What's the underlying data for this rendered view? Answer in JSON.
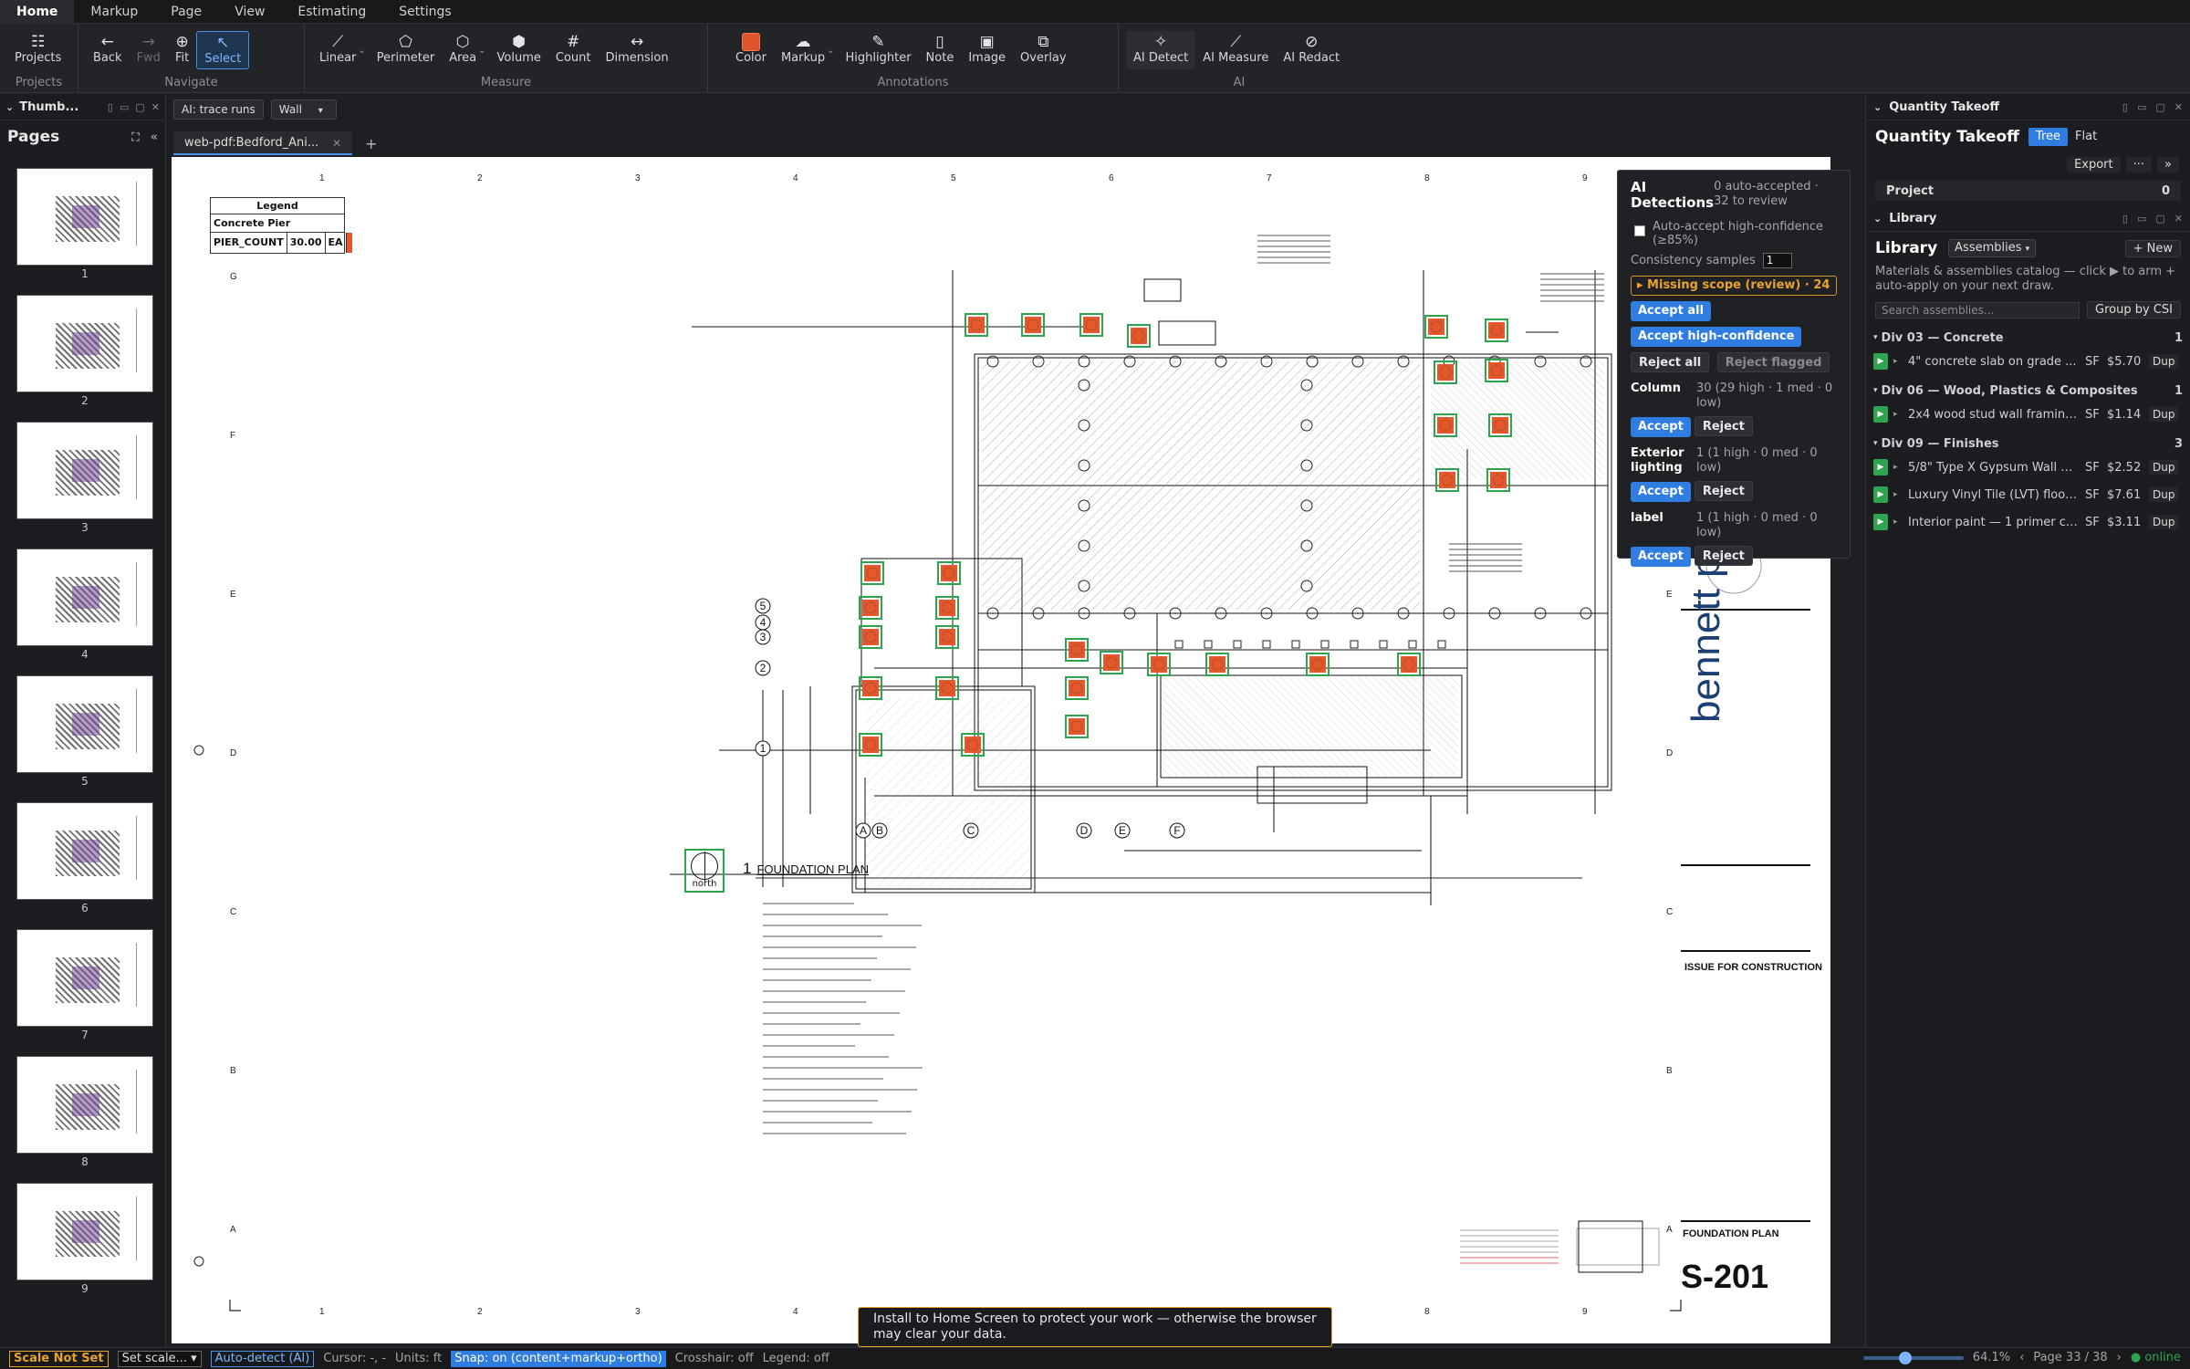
{
  "menubar": [
    "Home",
    "Markup",
    "Page",
    "View",
    "Estimating",
    "Settings"
  ],
  "ribbon": {
    "projects": {
      "label": "Projects",
      "group": "Projects"
    },
    "navigate": {
      "back": "Back",
      "fwd": "Fwd",
      "fit": "Fit",
      "select": "Select",
      "group": "Navigate"
    },
    "measure": {
      "linear": "Linear",
      "perimeter": "Perimeter",
      "area": "Area",
      "volume": "Volume",
      "count": "Count",
      "dimension": "Dimension",
      "group": "Measure"
    },
    "annotations": {
      "color": "Color",
      "markup": "Markup",
      "highlighter": "Highlighter",
      "note": "Note",
      "image": "Image",
      "overlay": "Overlay",
      "group": "Annotations"
    },
    "ai": {
      "detect": "AI Detect",
      "measure": "AI Measure",
      "redact": "AI Redact",
      "group": "AI"
    },
    "accent_color": "#e0542b"
  },
  "left": {
    "thumbs_label": "Thumb...",
    "pages_label": "Pages",
    "pages": [
      "1",
      "2",
      "3",
      "4",
      "5",
      "6",
      "7",
      "8",
      "9"
    ]
  },
  "canvas_toolbar": {
    "trace": "AI: trace runs",
    "wall": "Wall"
  },
  "tab": {
    "name": "web-pdf:Bedford_Ani..."
  },
  "drawing": {
    "legend_title": "Legend",
    "legend_item": "Concrete Pier",
    "legend_count_label": "PIER_COUNT",
    "legend_count_value": "30.00",
    "legend_unit": "EA",
    "plan_num": "1",
    "plan_title": "FOUNDATION PLAN",
    "north": "north",
    "firm": "bennett partners",
    "issue": "ISSUE FOR CONSTRUCTION",
    "sheet_title": "FOUNDATION PLAN",
    "sheet_num": "S-201",
    "top_cols": [
      "1",
      "2",
      "3",
      "4",
      "5",
      "6",
      "7",
      "8",
      "9"
    ],
    "rows": [
      "G",
      "F",
      "E",
      "D",
      "C",
      "B",
      "A"
    ],
    "grid_letters": [
      "A",
      "B",
      "C",
      "D",
      "E",
      "F"
    ],
    "grid_numbers": [
      "5",
      "4",
      "3",
      "2",
      "1"
    ]
  },
  "ai_panel": {
    "title": "AI Detections",
    "count": "0 auto-accepted · 32 to review",
    "auto_accept": "Auto-accept high-confidence (≥85%)",
    "consistency_label": "Consistency samples",
    "consistency_value": "1",
    "missing": "▸ Missing scope (review) · 24",
    "accept_all": "Accept all",
    "accept_high": "Accept high-confidence",
    "reject_all": "Reject all",
    "reject_flagged": "Reject flagged",
    "accept": "Accept",
    "reject": "Reject",
    "detections": [
      {
        "name": "Column",
        "detail": "30 (29 high · 1 med · 0 low)"
      },
      {
        "name": "Exterior lighting",
        "detail": "1 (1 high · 0 med · 0 low)"
      },
      {
        "name": "label",
        "detail": "1 (1 high · 0 med · 0 low)"
      }
    ]
  },
  "right": {
    "qt_head": "Quantity Takeoff",
    "qt_title": "Quantity Takeoff",
    "tree": "Tree",
    "flat": "Flat",
    "export": "Export",
    "more": "···",
    "expand": "»",
    "project": "Project",
    "project_count": "0",
    "lib_head": "Library",
    "lib_title": "Library",
    "assemblies": "Assemblies",
    "new": "+ New",
    "desc": "Materials & assemblies catalog — click ▶ to arm + auto-apply on your next draw.",
    "search_placeholder": "Search assemblies...",
    "group_by": "Group by CSI",
    "dup": "Dup",
    "divisions": [
      {
        "name": "Div 03 — Concrete",
        "count": "1",
        "items": [
          {
            "name": "4\" concrete slab on grade ...",
            "unit": "SF",
            "price": "$5.70"
          }
        ]
      },
      {
        "name": "Div 06 — Wood, Plastics & Composites",
        "count": "1",
        "items": [
          {
            "name": "2x4 wood stud wall framing...",
            "unit": "SF",
            "price": "$1.14"
          }
        ]
      },
      {
        "name": "Div 09 — Finishes",
        "count": "3",
        "items": [
          {
            "name": "5/8\" Type X Gypsum Wall B...",
            "unit": "SF",
            "price": "$2.52"
          },
          {
            "name": "Luxury Vinyl Tile (LVT) floor...",
            "unit": "SF",
            "price": "$7.61"
          },
          {
            "name": "Interior paint — 1 primer co...",
            "unit": "SF",
            "price": "$3.11"
          }
        ]
      }
    ]
  },
  "status": {
    "scale": "Scale Not Set",
    "set_scale": "Set scale... ▾",
    "auto_detect": "Auto-detect (AI)",
    "cursor": "Cursor: -, -",
    "units": "Units: ft",
    "snap": "Snap: on (content+markup+ortho)",
    "crosshair": "Crosshair: off",
    "legend": "Legend: off",
    "zoom": "64.1%",
    "page": "Page 33 / 38",
    "online": "● online",
    "zoom_fraction": 0.42
  },
  "toast": "Install to Home Screen to protect your work — otherwise the browser may clear your data."
}
